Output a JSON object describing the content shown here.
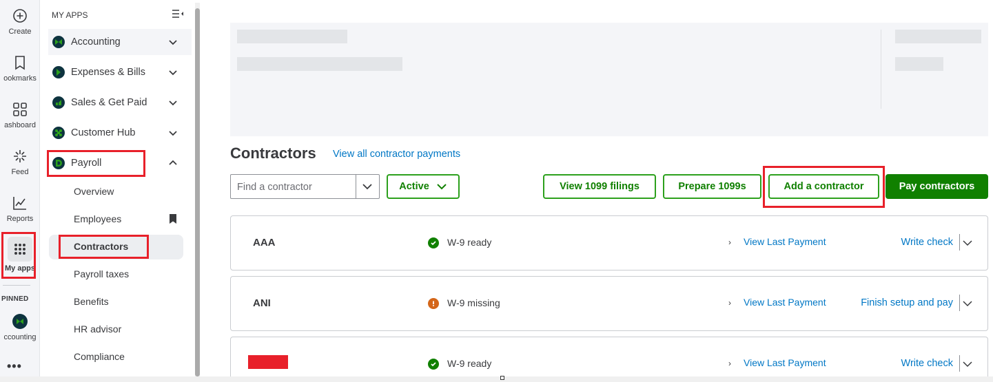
{
  "rail": {
    "create": "Create",
    "bookmarks": "ookmarks",
    "dashboard": "ashboard",
    "feed": "Feed",
    "reports": "Reports",
    "my_apps": "My apps",
    "pinned": "PINNED",
    "pinned_accounting": "ccounting",
    "more": "•••"
  },
  "apps_panel": {
    "heading": "MY APPS",
    "apps": [
      {
        "label": "Accounting"
      },
      {
        "label": "Expenses & Bills"
      },
      {
        "label": "Sales & Get Paid"
      },
      {
        "label": "Customer Hub"
      },
      {
        "label": "Payroll"
      }
    ],
    "payroll_items": [
      {
        "label": "Overview"
      },
      {
        "label": "Employees"
      },
      {
        "label": "Contractors"
      },
      {
        "label": "Payroll taxes"
      },
      {
        "label": "Benefits"
      },
      {
        "label": "HR advisor"
      },
      {
        "label": "Compliance"
      }
    ]
  },
  "main": {
    "title": "Contractors",
    "view_all_link": "View all contractor payments",
    "search_placeholder": "Find a contractor",
    "filter_label": "Active",
    "buttons": {
      "view_1099": "View 1099 filings",
      "prepare_1099": "Prepare 1099s",
      "add_contractor": "Add a contractor",
      "pay_contractors": "Pay contractors"
    },
    "contractors": [
      {
        "name": "AAA",
        "status": "W-9 ready",
        "status_type": "ready",
        "last_payment": "View Last Payment",
        "action": "Write check"
      },
      {
        "name": "ANI",
        "status": "W-9 missing",
        "status_type": "missing",
        "last_payment": "View Last Payment",
        "action": "Finish setup and pay"
      },
      {
        "name": "",
        "status": "W-9 ready",
        "status_type": "ready",
        "last_payment": "View Last Payment",
        "action": "Write check"
      }
    ]
  },
  "colors": {
    "brand_green": "#2ca01c",
    "dark_green": "#108000",
    "link_blue": "#0077c5",
    "highlight_red": "#e8202a",
    "warning_orange": "#d4661a"
  }
}
